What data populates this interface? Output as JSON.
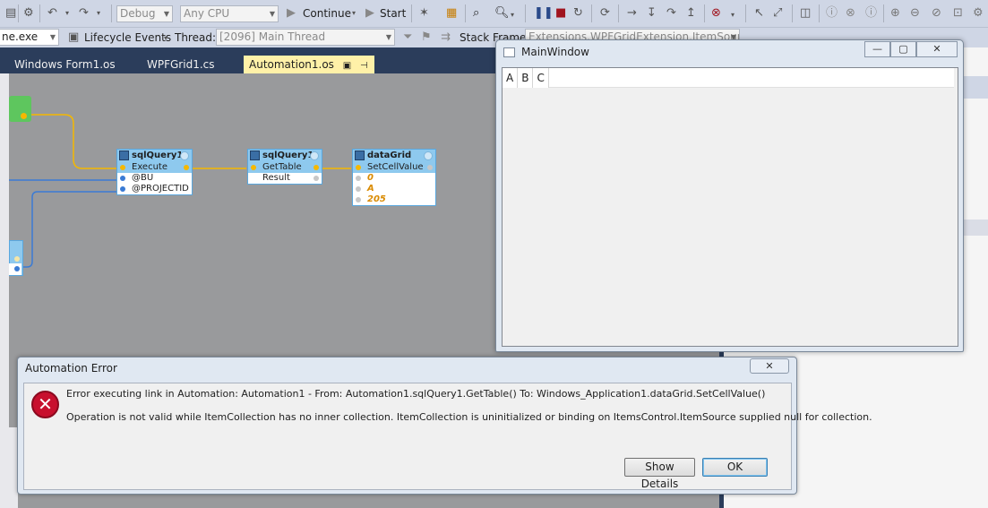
{
  "toolbar": {
    "config": "Debug",
    "platform": "Any CPU",
    "continue_label": "Continue",
    "start_label": "Start"
  },
  "toolbar2": {
    "process": "ne.exe",
    "lifecycle_label": "Lifecycle Events",
    "thread_label": "Thread:",
    "thread_value": "[2096] Main Thread",
    "stackframe_label": "Stack Frame:",
    "stackframe_value": "Extensions.WPFGridExtension.ItemSource"
  },
  "tabs": [
    {
      "label": "Windows Form1.os"
    },
    {
      "label": "WPFGrid1.cs"
    },
    {
      "label": "Automation1.os"
    }
  ],
  "nodes": {
    "sq1": {
      "title": "sqlQuery1",
      "rows": [
        "Execute",
        "@BU",
        "@PROJECTID"
      ]
    },
    "sq2": {
      "title": "sqlQuery1",
      "rows": [
        "GetTable",
        "Result"
      ]
    },
    "dg": {
      "title": "dataGrid",
      "rows": [
        "SetCellValue",
        "0",
        "A",
        "205"
      ]
    }
  },
  "mainwindow": {
    "title": "MainWindow",
    "columns": [
      "A",
      "B",
      "C"
    ]
  },
  "dialog": {
    "title": "Automation Error",
    "message1": "Error executing link in Automation: Automation1 - From: Automation1.sqlQuery1.GetTable() To: Windows_Application1.dataGrid.SetCellValue()",
    "message2": "Operation is not valid while ItemCollection has no inner collection. ItemCollection is uninitialized or binding on ItemsControl.ItemSource supplied null for collection.",
    "show_details_label": "Show Details",
    "ok_label": "OK"
  },
  "icons": {
    "error": "error-x-icon"
  }
}
